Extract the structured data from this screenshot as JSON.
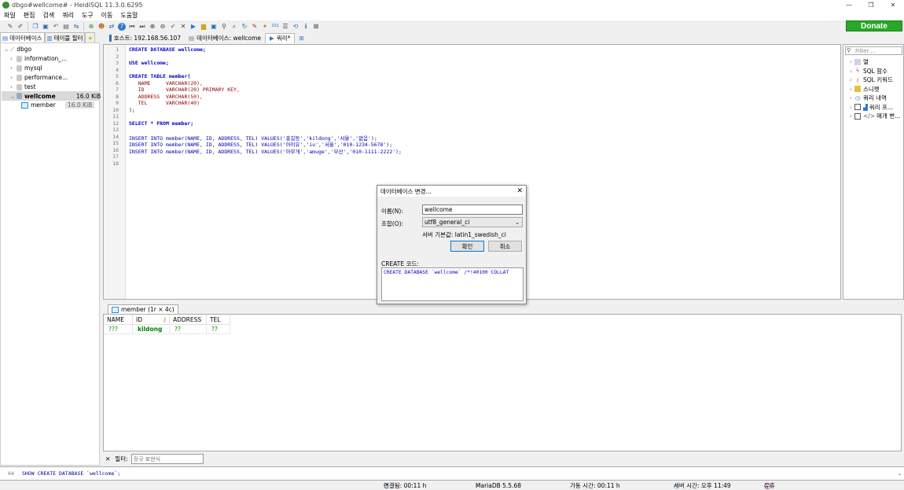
{
  "window": {
    "title": "dbgo#wellcome# - HeidiSQL 11.3.0.6295",
    "minimize": "—",
    "restore": "❐",
    "close": "✕"
  },
  "menu": [
    "파일",
    "편집",
    "검색",
    "쿼리",
    "도구",
    "이동",
    "도움말"
  ],
  "toolbar": {
    "donate_label": "Donate"
  },
  "left_tabs": {
    "db_tab": "데이터베이스",
    "table_filter_tab": "테이블 필터"
  },
  "tree": {
    "root": "dbgo",
    "items": [
      {
        "label": "information_..."
      },
      {
        "label": "mysql"
      },
      {
        "label": "performance..."
      },
      {
        "label": "test"
      }
    ],
    "selected_db": {
      "label": "wellcome",
      "size": "16.0 KiB"
    },
    "table": {
      "label": "member",
      "size": "16.0 KiB"
    }
  },
  "query_tabs": {
    "host": "호스트: 192.168.56.107",
    "database": "데이터베이스: wellcome",
    "query": "쿼리*"
  },
  "editor": {
    "line_numbers": [
      "1",
      "2",
      "3",
      "4",
      "5",
      "6",
      "7",
      "8",
      "9",
      "10",
      "11",
      "12",
      "13",
      "14",
      "15",
      "16",
      "17",
      "18"
    ],
    "lines": {
      "l1": "CREATE DATABASE wellcome;",
      "l3": "USE wellcome;",
      "l5": "CREATE TABLE member(",
      "l6": "   NAME     VARCHAR(20),",
      "l7": "   ID       VARCHAR(20) PRIMARY KEY,",
      "l8": "   ADDRESS  VARCHAR(50),",
      "l9": "   TEL      VARCHAR(40)",
      "l10": ");",
      "l12": "SELECT * FROM member;",
      "l14": "INSERT INTO member(NAME, ID, ADDRESS, TEL) VALUES('홍길동','kildong','서울','없음');",
      "l15": "INSERT INTO member(NAME, ID, ADDRESS, TEL) VALUES('아이유','iu','서울','010-1234-5678');",
      "l16": "INSERT INTO member(NAME, ID, ADDRESS, TEL) VALUES('아무개','amuge','부산','010-1111-2222');"
    }
  },
  "right_panel": {
    "filter_placeholder": "Filter ...",
    "items": [
      "열",
      "SQL 함수",
      "SQL 키워드",
      "스니펫",
      "쿼리 내역",
      "쿼리 프...",
      "매개 변..."
    ]
  },
  "result": {
    "tab_label": "member (1r × 4c)",
    "columns": [
      "NAME",
      "ID",
      "ADDRESS",
      "TEL"
    ],
    "row": [
      "???",
      "kildong",
      "??",
      "??"
    ]
  },
  "filter_bar": {
    "close": "✕",
    "label": "필터:",
    "placeholder": "정규 표현식"
  },
  "log": {
    "line_no": "64",
    "text": "SHOW CREATE DATABASE `wellcome`;"
  },
  "status": {
    "connected": "연결됨: 00:11 h",
    "server": "MariaDB 5.5.68",
    "uptime": "가동 시간: 00:11 h",
    "server_time": "서버 시간: 오후 11:49",
    "idle": "유휴"
  },
  "dialog": {
    "title": "데이터베이스 변경...",
    "close": "✕",
    "name_label": "이름(N):",
    "name_value": "wellcome",
    "collation_label": "조합(O):",
    "collation_value": "utf8_general_ci",
    "server_default": "서버 기본값: latin1_swedish_ci",
    "ok": "확인",
    "cancel": "취소",
    "create_code_label": "CREATE 코드:",
    "create_code": "CREATE DATABASE `wellcome` /*!40100 COLLAT"
  }
}
